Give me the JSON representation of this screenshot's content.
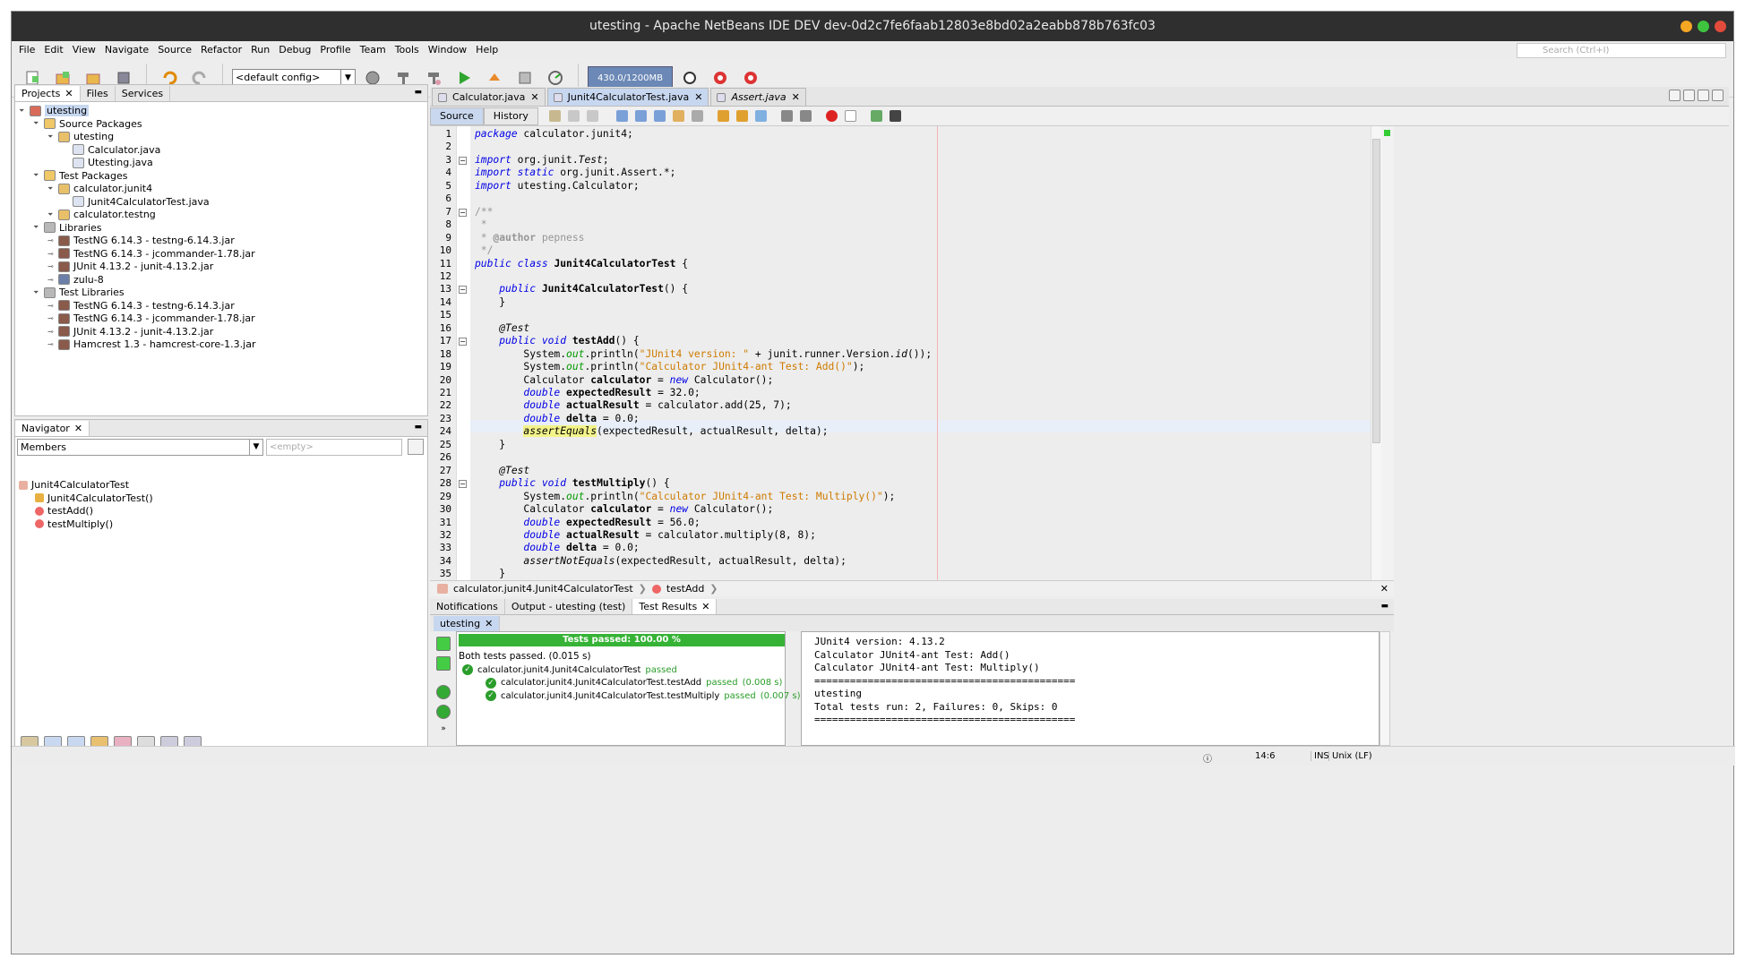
{
  "window": {
    "title": "utesting - Apache NetBeans IDE DEV dev-0d2c7fe6faab12803e8bd02a2eabb878b763fc03"
  },
  "menubar": [
    "File",
    "Edit",
    "View",
    "Navigate",
    "Source",
    "Refactor",
    "Run",
    "Debug",
    "Profile",
    "Team",
    "Tools",
    "Window",
    "Help"
  ],
  "search": {
    "placeholder": "Search (Ctrl+I)"
  },
  "toolbar": {
    "config": "<default config>",
    "memory": "430.0/1200MB"
  },
  "projects": {
    "tabs": [
      "Projects",
      "Files",
      "Services"
    ],
    "tree": [
      {
        "label": "utesting",
        "level": 0,
        "icon": "project"
      },
      {
        "label": "Source Packages",
        "level": 1,
        "icon": "folder"
      },
      {
        "label": "utesting",
        "level": 2,
        "icon": "package"
      },
      {
        "label": "Calculator.java",
        "level": 3,
        "icon": "java"
      },
      {
        "label": "Utesting.java",
        "level": 3,
        "icon": "java"
      },
      {
        "label": "Test Packages",
        "level": 1,
        "icon": "folder"
      },
      {
        "label": "calculator.junit4",
        "level": 2,
        "icon": "package"
      },
      {
        "label": "Junit4CalculatorTest.java",
        "level": 3,
        "icon": "java"
      },
      {
        "label": "calculator.testng",
        "level": 2,
        "icon": "package"
      },
      {
        "label": "Libraries",
        "level": 1,
        "icon": "library"
      },
      {
        "label": "TestNG 6.14.3 - testng-6.14.3.jar",
        "level": 2,
        "icon": "jar"
      },
      {
        "label": "TestNG 6.14.3 - jcommander-1.78.jar",
        "level": 2,
        "icon": "jar"
      },
      {
        "label": "JUnit 4.13.2 - junit-4.13.2.jar",
        "level": 2,
        "icon": "jar"
      },
      {
        "label": "zulu-8",
        "level": 2,
        "icon": "jdk"
      },
      {
        "label": "Test Libraries",
        "level": 1,
        "icon": "library"
      },
      {
        "label": "TestNG 6.14.3 - testng-6.14.3.jar",
        "level": 2,
        "icon": "jar"
      },
      {
        "label": "TestNG 6.14.3 - jcommander-1.78.jar",
        "level": 2,
        "icon": "jar"
      },
      {
        "label": "JUnit 4.13.2 - junit-4.13.2.jar",
        "level": 2,
        "icon": "jar"
      },
      {
        "label": "Hamcrest 1.3 - hamcrest-core-1.3.jar",
        "level": 2,
        "icon": "jar"
      }
    ]
  },
  "navigator": {
    "title": "Navigator",
    "filter": "Members",
    "filter2": "<empty>",
    "items": [
      {
        "label": "Junit4CalculatorTest",
        "level": 0
      },
      {
        "label": "Junit4CalculatorTest()",
        "level": 1
      },
      {
        "label": "testAdd()",
        "level": 1
      },
      {
        "label": "testMultiply()",
        "level": 1
      }
    ]
  },
  "editor": {
    "tabs": [
      "Calculator.java",
      "Junit4CalculatorTest.java",
      "Assert.java"
    ],
    "source_btn": "Source",
    "history_btn": "History",
    "lines": [
      "<span class='kw it'>package</span> calculator.junit4;",
      "",
      "<span class='kw it'>import</span> org.junit.<span class='it'>Test</span>;",
      "<span class='kw it'>import static</span> org.junit.Assert.*;",
      "<span class='kw it'>import</span> utesting.Calculator;",
      "",
      "<span class='cm'>/**</span>",
      "<span class='cm'> *</span>",
      "<span class='cm'> * <b>@author</b> pepness</span>",
      "<span class='cm'> */</span>",
      "<span class='kw it'>public class</span> <span class='b'>Junit4CalculatorTest</span> {",
      "",
      "    <span class='kw it'>public</span> <span class='b'>Junit4CalculatorTest</span>() {",
      "    }",
      "",
      "    <span class='it'>@Test</span>",
      "    <span class='kw it'>public void</span> <span class='b'>testAdd</span>() {",
      "        System.<span class='fld'>out</span>.println(<span class='str'>\"JUnit4 version: \"</span> + junit.runner.Version.<span class='it'>id</span>());",
      "        System.<span class='fld'>out</span>.println(<span class='str'>\"Calculator JUnit4-ant Test: Add()\"</span>);",
      "        Calculator <span class='b'>calculator</span> = <span class='kw it'>new</span> Calculator();",
      "        <span class='kw it'>double</span> <span class='b'>expectedResult</span> = 32.0;",
      "        <span class='kw it'>double</span> <span class='b'>actualResult</span> = calculator.add(25, 7);",
      "        <span class='kw it'>double</span> <span class='b'>delta</span> = 0.0;",
      "        <span class='it' style='background:#f3f38a'>assertEquals</span>(expectedResult, actualResult, delta);",
      "    }",
      "",
      "    <span class='it'>@Test</span>",
      "    <span class='kw it'>public void</span> <span class='b'>testMultiply</span>() {",
      "        System.<span class='fld'>out</span>.println(<span class='str'>\"Calculator JUnit4-ant Test: Multiply()\"</span>);",
      "        Calculator <span class='b'>calculator</span> = <span class='kw it'>new</span> Calculator();",
      "        <span class='kw it'>double</span> <span class='b'>expectedResult</span> = 56.0;",
      "        <span class='kw it'>double</span> <span class='b'>actualResult</span> = calculator.multiply(8, 8);",
      "        <span class='kw it'>double</span> <span class='b'>delta</span> = 0.0;",
      "        <span class='it'>assertNotEquals</span>(expectedResult, actualResult, delta);",
      "    }"
    ],
    "breadcrumb": [
      "calculator.junit4.Junit4CalculatorTest",
      "testAdd"
    ]
  },
  "output": {
    "tabs": [
      "Notifications",
      "Output - utesting (test)",
      "Test Results"
    ],
    "subtab": "utesting",
    "progress_label": "Tests passed: 100.00 %",
    "summary": "Both tests passed. (0.015 s)",
    "results": [
      {
        "name": "calculator.junit4.Junit4CalculatorTest",
        "status": "passed",
        "time": ""
      },
      {
        "name": "calculator.junit4.Junit4CalculatorTest.testAdd",
        "status": "passed",
        "time": "(0.008 s)"
      },
      {
        "name": "calculator.junit4.Junit4CalculatorTest.testMultiply",
        "status": "passed",
        "time": "(0.007 s)"
      }
    ],
    "console": [
      "JUnit4 version: 4.13.2",
      "Calculator JUnit4-ant Test: Add()",
      "Calculator JUnit4-ant Test: Multiply()",
      "============================================",
      "utesting",
      "Total tests run: 2, Failures: 0, Skips: 0",
      "============================================"
    ]
  },
  "status": {
    "position": "14:6",
    "mode": "INS",
    "eol": "Unix (LF)"
  },
  "colors": {
    "accent": "#c7d7f0",
    "pass": "#36b336",
    "keyword": "#0000e6",
    "string": "#ce7b00"
  }
}
